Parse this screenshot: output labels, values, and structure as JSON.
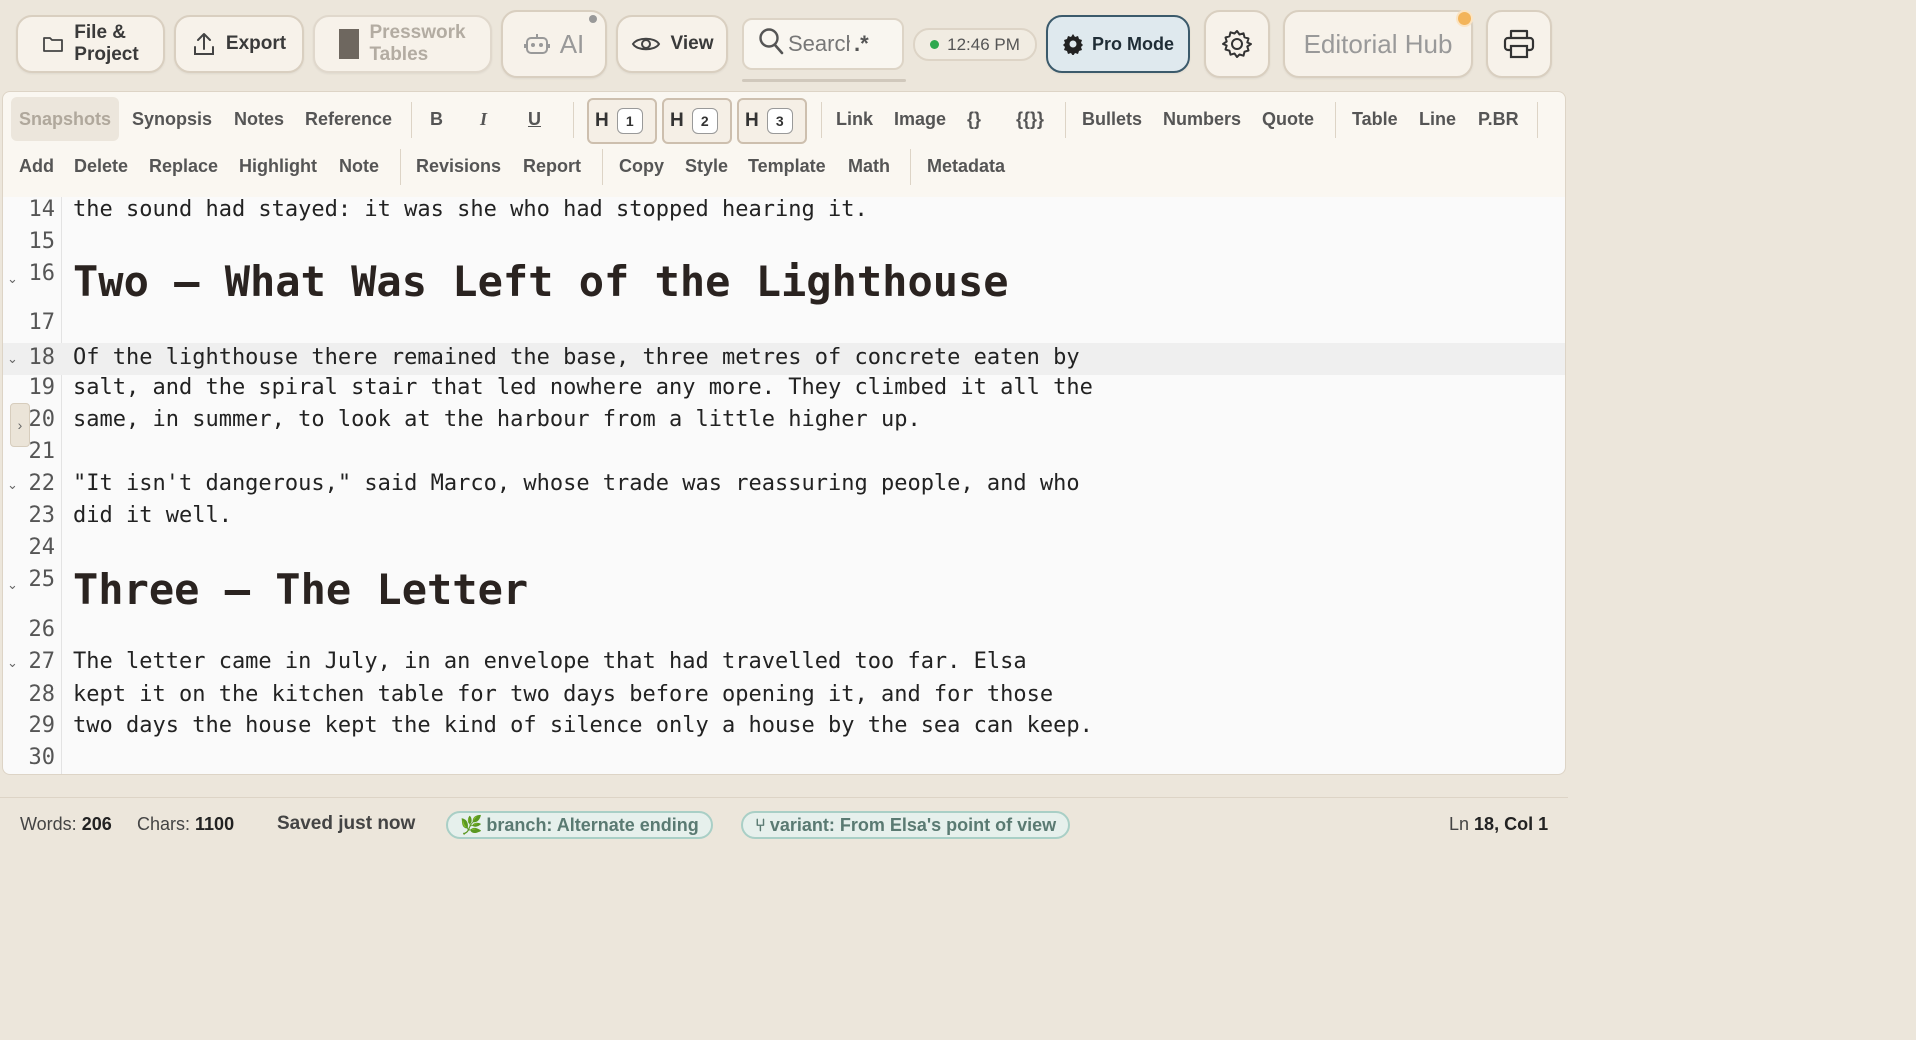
{
  "toolbar": {
    "file_project": [
      "File &",
      "Project"
    ],
    "export": "Export",
    "presswork_tables": [
      "Presswork",
      "Tables"
    ],
    "ai": "AI",
    "view": "View",
    "search_placeholder": "Search",
    "search_regex": ".*",
    "clock": "12:46 PM",
    "pro_mode": "Pro Mode",
    "editorial_hub": "Editorial Hub"
  },
  "format_row1": {
    "snapshots": "Snapshots",
    "synopsis": "Synopsis",
    "notes": "Notes",
    "reference": "Reference",
    "bold": "B",
    "italic": "I",
    "underline": "U",
    "h_label": "H",
    "h1": "1",
    "h2": "2",
    "h3": "3",
    "link": "Link",
    "image": "Image",
    "braces": "{}",
    "double_braces": "{{}}",
    "bullets": "Bullets",
    "numbers": "Numbers",
    "quote": "Quote",
    "table": "Table",
    "line": "Line",
    "pbr": "P.BR"
  },
  "format_row2": {
    "add": "Add",
    "delete": "Delete",
    "replace": "Replace",
    "highlight": "Highlight",
    "note": "Note",
    "revisions": "Revisions",
    "report": "Report",
    "copy": "Copy",
    "style": "Style",
    "template": "Template",
    "math": "Math",
    "metadata": "Metadata"
  },
  "editor": {
    "lines": [
      {
        "n": "14",
        "text": "the sound had stayed: it was she who had stopped hearing it."
      },
      {
        "n": "15",
        "text": ""
      },
      {
        "n": "16",
        "text": "Two — What Was Left of the Lighthouse"
      },
      {
        "n": "17",
        "text": ""
      },
      {
        "n": "18",
        "text": "Of the lighthouse there remained the base, three metres of concrete eaten by"
      },
      {
        "n": "19",
        "text": "salt, and the spiral stair that led nowhere any more. They climbed it all the"
      },
      {
        "n": "20",
        "text": "same, in summer, to look at the harbour from a little higher up."
      },
      {
        "n": "21",
        "text": ""
      },
      {
        "n": "22",
        "text": "\"It isn't dangerous,\" said Marco, whose trade was reassuring people, and who"
      },
      {
        "n": "23",
        "text": "did it well."
      },
      {
        "n": "24",
        "text": ""
      },
      {
        "n": "25",
        "text": "Three — The Letter"
      },
      {
        "n": "26",
        "text": ""
      },
      {
        "n": "27",
        "text": "The letter came in July, in an envelope that had travelled too far. Elsa"
      },
      {
        "n": "28",
        "text": "kept it on the kitchen table for two days before opening it, and for those"
      },
      {
        "n": "29",
        "text": "two days the house kept the kind of silence only a house by the sea can keep."
      },
      {
        "n": "30",
        "text": ""
      }
    ]
  },
  "status": {
    "words_label": "Words:",
    "words": "206",
    "chars_label": "Chars:",
    "chars": "1100",
    "saved": "Saved just now",
    "branch": "branch: Alternate ending",
    "variant": "variant: From Elsa's point of view",
    "ln_label": "Ln",
    "ln": "18",
    "col_label": "Col",
    "col": "1"
  },
  "colors": {
    "background": "#ece6db",
    "pro_mode_bg": "#dfe9ee",
    "clock_dot": "#2fa84f",
    "notification": "#f3b45a",
    "branch_pill": "#e6f0ec"
  }
}
